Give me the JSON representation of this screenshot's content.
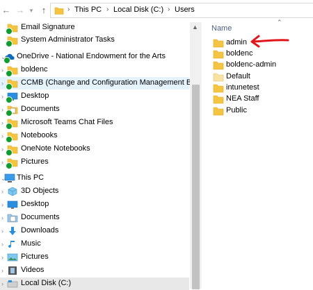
{
  "address": {
    "crumbs": [
      "This PC",
      "Local Disk (C:)",
      "Users"
    ]
  },
  "nav": {
    "items": [
      {
        "label": "Email Signature",
        "icon": "folder",
        "tick": true
      },
      {
        "label": "System Administrator Tasks",
        "icon": "folder",
        "tick": true
      },
      {
        "label": "OneDrive - National Endowment for the Arts",
        "icon": "onedrive",
        "tick": true
      },
      {
        "label": "boldenc",
        "icon": "folder",
        "tick": true
      },
      {
        "label": "CCMB (Change and Configuration Management Board)",
        "icon": "folder",
        "tick": true
      },
      {
        "label": "Desktop",
        "icon": "desktop",
        "tick": true
      },
      {
        "label": "Documents",
        "icon": "documents",
        "tick": true
      },
      {
        "label": "Microsoft Teams Chat Files",
        "icon": "folder",
        "tick": true
      },
      {
        "label": "Notebooks",
        "icon": "folder",
        "tick": true
      },
      {
        "label": "OneNote Notebooks",
        "icon": "folder",
        "tick": true
      },
      {
        "label": "Pictures",
        "icon": "folder",
        "tick": true
      },
      {
        "label": "This PC",
        "icon": "pc",
        "tick": false
      },
      {
        "label": "3D Objects",
        "icon": "3d",
        "tick": false
      },
      {
        "label": "Desktop",
        "icon": "desktop",
        "tick": false
      },
      {
        "label": "Documents",
        "icon": "documents",
        "tick": false
      },
      {
        "label": "Downloads",
        "icon": "downloads",
        "tick": false
      },
      {
        "label": "Music",
        "icon": "music",
        "tick": false
      },
      {
        "label": "Pictures",
        "icon": "pictures",
        "tick": false
      },
      {
        "label": "Videos",
        "icon": "videos",
        "tick": false
      },
      {
        "label": "Local Disk (C:)",
        "icon": "disk",
        "tick": false
      }
    ]
  },
  "content": {
    "column_header": "Name",
    "files": [
      "admin",
      "boldenc",
      "boldenc-admin",
      "Default",
      "intunetest",
      "NEA Staff",
      "Public"
    ]
  },
  "colors": {
    "folder": "#f5c542",
    "accent": "#0078d7",
    "annotation": "#e0161b"
  }
}
